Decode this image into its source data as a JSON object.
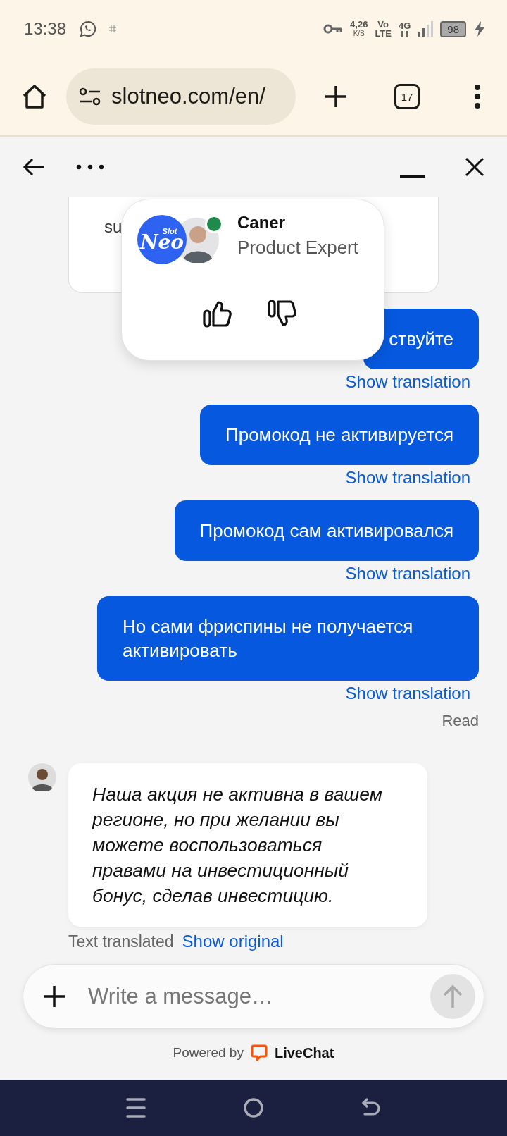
{
  "status_bar": {
    "time": "13:38",
    "speed": "4,26",
    "speed_unit": "K/S",
    "volte_top": "Vo",
    "volte_bottom": "LTE",
    "generation": "4G",
    "battery": "98"
  },
  "browser": {
    "url": "slotneo.com/en/",
    "tab_count": "17"
  },
  "chat": {
    "partial_card_text": "su",
    "agent_popup": {
      "logo_small": "Slot",
      "logo_big": "Neo",
      "name": "Caner",
      "role": "Product Expert",
      "online": true
    },
    "messages": [
      {
        "kind": "visitor",
        "text": "ствуйте",
        "link": "Show translation"
      },
      {
        "kind": "visitor",
        "text": "Промокод не активируется",
        "link": "Show translation"
      },
      {
        "kind": "visitor",
        "text": "Промокод сам активировался",
        "link": "Show translation"
      },
      {
        "kind": "visitor",
        "text": "Но сами фриспины не получается активировать",
        "link": "Show translation",
        "status": "Read"
      },
      {
        "kind": "agent",
        "text": "Наша акция не активна в вашем регионе, но при желании вы можете воспользоваться правами на инвестиционный бонус, сделав инвестицию.",
        "note": "Text translated",
        "link": "Show original"
      }
    ],
    "input": {
      "placeholder": "Write a message…"
    },
    "powered_by": "Powered by",
    "brand": "LiveChat"
  }
}
